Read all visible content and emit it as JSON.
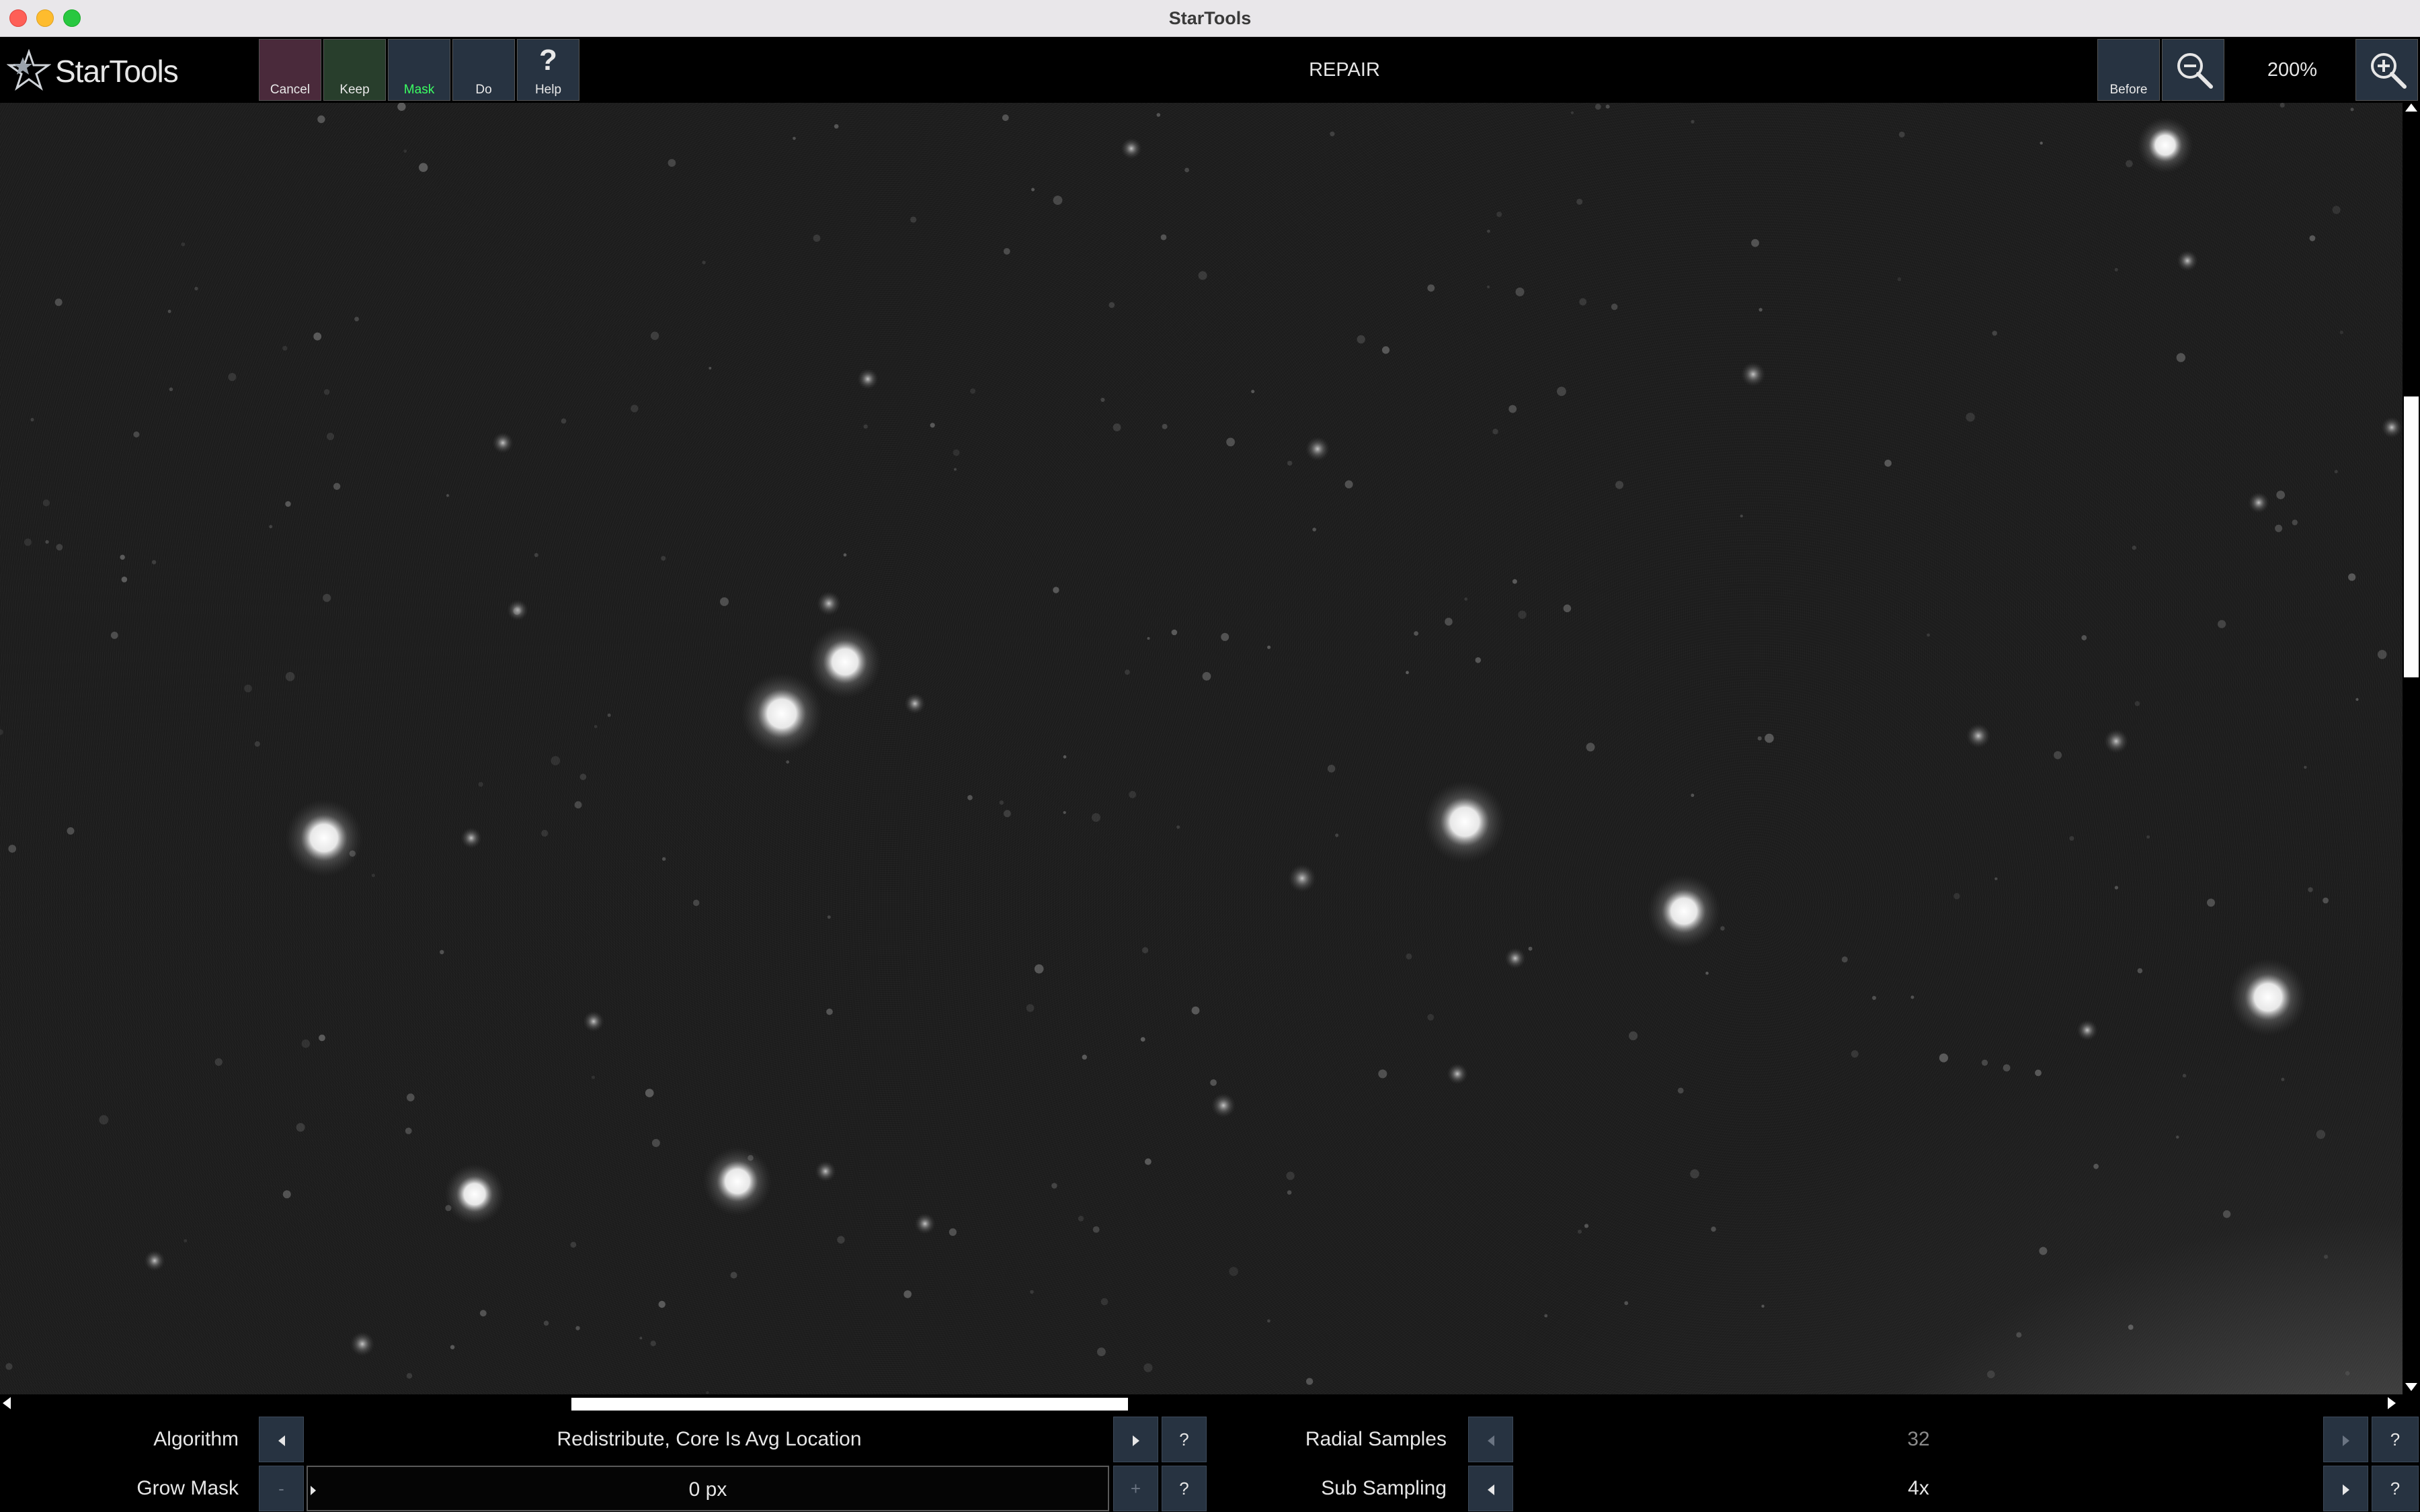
{
  "window": {
    "title": "StarTools"
  },
  "toolbar": {
    "logo_text": "StarTools",
    "cancel_label": "Cancel",
    "keep_label": "Keep",
    "mask_label": "Mask",
    "do_label": "Do",
    "help_label": "Help",
    "help_glyph": "?",
    "module_title": "REPAIR",
    "before_label": "Before",
    "zoom_level": "200%",
    "zoom_out_icon": "zoom-out-icon",
    "zoom_in_icon": "zoom-in-icon"
  },
  "params": {
    "algorithm": {
      "label": "Algorithm",
      "value": "Redistribute, Core Is Avg Location",
      "help": "?"
    },
    "grow_mask": {
      "label": "Grow Mask",
      "value": "0 px",
      "minus": "-",
      "plus": "+",
      "help": "?"
    },
    "radial_samples": {
      "label": "Radial Samples",
      "value": "32",
      "help": "?"
    },
    "sub_sampling": {
      "label": "Sub Sampling",
      "value": "4x",
      "help": "?"
    }
  },
  "colors": {
    "cancel_bg": "#4a2a3b",
    "keep_bg": "#283e2c",
    "button_bg": "#273341",
    "mask_label": "#3bff62"
  }
}
